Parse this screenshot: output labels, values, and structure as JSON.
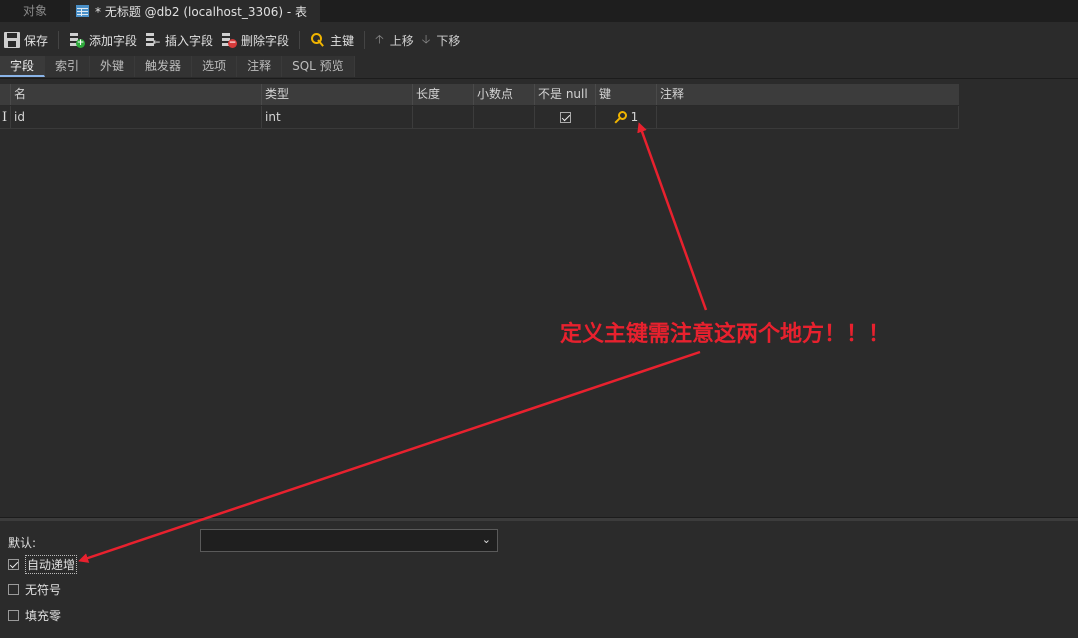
{
  "tabs": {
    "objects_label": "对象",
    "document_title": "* 无标题 @db2 (localhost_3306) - 表"
  },
  "toolbar": {
    "save": "保存",
    "add_field": "添加字段",
    "insert_field": "插入字段",
    "delete_field": "删除字段",
    "primary_key": "主键",
    "move_up": "上移",
    "move_down": "下移"
  },
  "subtabs": [
    "字段",
    "索引",
    "外键",
    "触发器",
    "选项",
    "注释",
    "SQL 预览"
  ],
  "grid": {
    "columns": [
      "名",
      "类型",
      "长度",
      "小数点",
      "不是 null",
      "键",
      "注释"
    ],
    "rows": [
      {
        "name": "id",
        "type": "int",
        "length": "",
        "decimals": "",
        "not_null": true,
        "key": "1",
        "comment": ""
      }
    ]
  },
  "bottom": {
    "default_label": "默认:",
    "default_value": "",
    "auto_increment": "自动递增",
    "auto_increment_checked": true,
    "unsigned": "无符号",
    "unsigned_checked": false,
    "zerofill": "填充零",
    "zerofill_checked": false
  },
  "annotation": {
    "text": "定义主键需注意这两个地方！！！",
    "color": "#e8212e"
  }
}
